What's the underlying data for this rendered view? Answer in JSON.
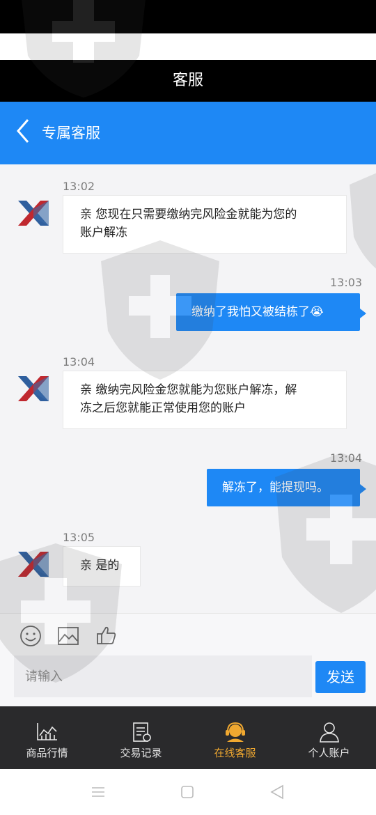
{
  "app_title": "客服",
  "nav": {
    "title": "专属客服",
    "back_icon": "chevron-left-icon"
  },
  "colors": {
    "accent": "#1e88f5",
    "active_tab": "#f0a830",
    "tab_bar_bg": "#2a2a2c"
  },
  "messages": [
    {
      "direction": "incoming",
      "time": "13:02",
      "lines": [
        "亲 您现在只需要缴纳完风险金就能为您的",
        "账户解冻"
      ]
    },
    {
      "direction": "outgoing",
      "time": "13:03",
      "text": "缴纳了我怕又被结栋了😭"
    },
    {
      "direction": "incoming",
      "time": "13:04",
      "lines": [
        "亲 缴纳完风险金您就能为您账户解冻，解",
        "冻之后您就能正常使用您的账户"
      ]
    },
    {
      "direction": "outgoing",
      "time": "13:04",
      "text": "解冻了，能提现吗。"
    },
    {
      "direction": "incoming",
      "time": "13:05",
      "lines": [
        "亲 是的"
      ]
    }
  ],
  "composer": {
    "tools": [
      "emoji-icon",
      "image-icon",
      "thumbs-up-icon"
    ],
    "placeholder": "请输入",
    "send_label": "发送"
  },
  "tabs": [
    {
      "label": "商品行情",
      "icon": "market-chart-icon",
      "active": false
    },
    {
      "label": "交易记录",
      "icon": "trade-record-icon",
      "active": false
    },
    {
      "label": "在线客服",
      "icon": "customer-service-icon",
      "active": true
    },
    {
      "label": "个人账户",
      "icon": "person-icon",
      "active": false
    }
  ],
  "system_nav": [
    "menu-icon",
    "home-icon",
    "back-icon"
  ]
}
